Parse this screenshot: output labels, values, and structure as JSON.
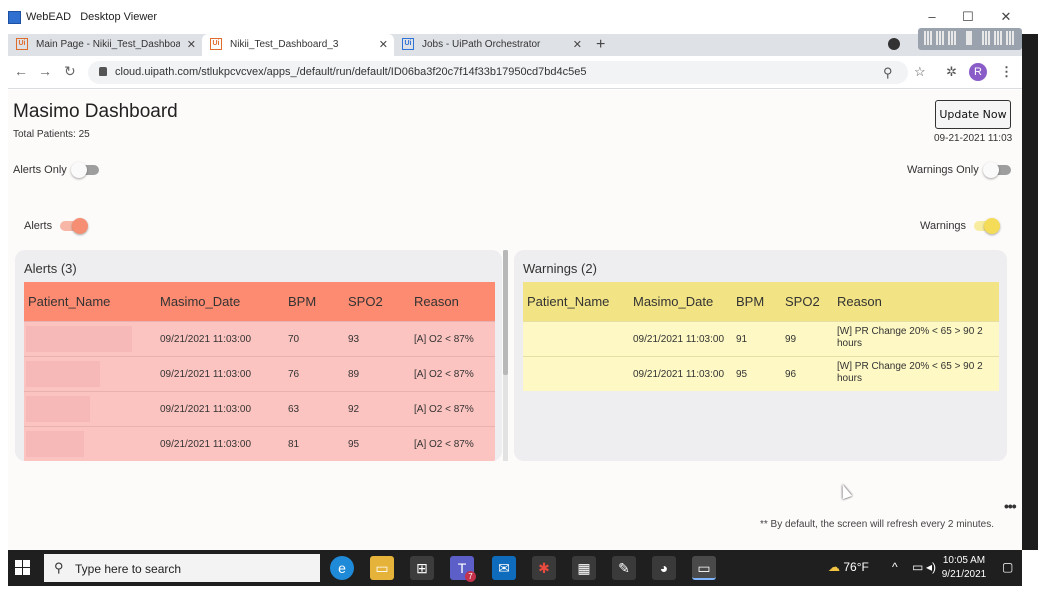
{
  "window": {
    "title_app": "WebEAD",
    "title_rest": "Desktop Viewer",
    "controls": [
      "–",
      "☐",
      "✕"
    ]
  },
  "browser": {
    "tabs": [
      {
        "label": "Main Page - Nikii_Test_Dashboar",
        "icon": "uipath-icon",
        "active": false
      },
      {
        "label": "Nikii_Test_Dashboard_3",
        "icon": "uipath-icon",
        "active": true
      },
      {
        "label": "Jobs - UiPath Orchestrator",
        "icon": "uipath-icon",
        "active": false
      }
    ],
    "new_tab": "+",
    "url": "cloud.uipath.com/stlukpcvcvex/apps_/default/run/default/ID06ba3f20c7f14f33b17950cd7bd4c5e5",
    "profile_initial": "R"
  },
  "dashboard": {
    "title": "Masimo Dashboard",
    "total_patients": "Total Patients: 25",
    "update_button": "Update Now",
    "update_time": "09-21-2021 11:03",
    "alerts_only_label": "Alerts Only",
    "warnings_only_label": "Warnings Only",
    "alerts_toggle_label": "Alerts",
    "warnings_toggle_label": "Warnings",
    "toggles": {
      "alerts_only": false,
      "warnings_only": false,
      "alerts": true,
      "warnings": true
    },
    "colors": {
      "alerts_header": "#fc8b71",
      "alerts_row": "#fcc4c0",
      "warnings_header": "#f2e384",
      "warnings_row": "#fdf8c4",
      "alerts_toggle": "#f58e72",
      "warnings_toggle": "#f5dc58"
    },
    "columns": [
      "Patient_Name",
      "Masimo_Date",
      "BPM",
      "SPO2",
      "Reason"
    ],
    "alerts": {
      "title": "Alerts (3)",
      "rows": [
        {
          "date": "09/21/2021 11:03:00",
          "bpm": "70",
          "spo2": "93",
          "reason": "[A] O2 < 87%"
        },
        {
          "date": "09/21/2021 11:03:00",
          "bpm": "76",
          "spo2": "89",
          "reason": "[A] O2 < 87%"
        },
        {
          "date": "09/21/2021 11:03:00",
          "bpm": "63",
          "spo2": "92",
          "reason": "[A] O2 < 87%"
        },
        {
          "date": "09/21/2021 11:03:00",
          "bpm": "81",
          "spo2": "95",
          "reason": "[A] O2 < 87%"
        }
      ]
    },
    "warnings": {
      "title": "Warnings (2)",
      "rows": [
        {
          "date": "09/21/2021 11:03:00",
          "bpm": "91",
          "spo2": "99",
          "reason": "[W] PR Change 20% < 65 > 90 2 hours"
        },
        {
          "date": "09/21/2021 11:03:00",
          "bpm": "95",
          "spo2": "96",
          "reason": "[W] PR Change 20% < 65 > 90 2 hours"
        }
      ]
    },
    "more_menu": "•••",
    "refresh_note": "** By default, the screen will refresh every 2 minutes."
  },
  "taskbar": {
    "search_placeholder": "Type here to search",
    "teams_badge": "7",
    "weather": "76°F",
    "time": "10:05 AM",
    "date": "9/21/2021"
  }
}
